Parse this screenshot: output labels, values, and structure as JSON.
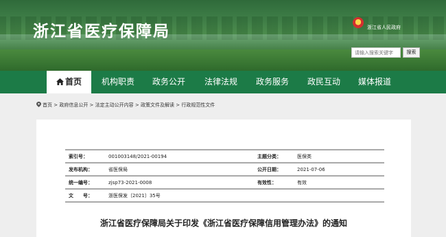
{
  "header": {
    "site_title": "浙江省医疗保障局",
    "gov_label": "浙江省人民政府",
    "search_placeholder": "请输入搜索关键字",
    "search_button": "搜索"
  },
  "nav": {
    "items": [
      {
        "label": "首页",
        "active": true
      },
      {
        "label": "机构职责"
      },
      {
        "label": "政务公开"
      },
      {
        "label": "法律法规"
      },
      {
        "label": "政务服务"
      },
      {
        "label": "政民互动"
      },
      {
        "label": "媒体报道"
      }
    ]
  },
  "breadcrumb": {
    "items": [
      "首页",
      "政府信息公开",
      "法定主动公开内容",
      "政策文件及解读",
      "行政规范性文件"
    ],
    "separator": " > "
  },
  "meta": {
    "index_label": "索引号：",
    "index_value": "001003148/2021-00194",
    "category_label": "主题分类：",
    "category_value": "医保类",
    "issuer_label": "发布机构：",
    "issuer_value": "省医保局",
    "date_label": "公开日期：",
    "date_value": "2021-07-06",
    "serial_label": "统一编号：",
    "serial_value": "zjsp73-2021-0008",
    "validity_label": "有效性：",
    "validity_value": "有效",
    "docno_label": "文　　号：",
    "docno_value": "浙医保发〔2021〕35号"
  },
  "document": {
    "title": "浙江省医疗保障局关于印发《浙江省医疗保障信用管理办法》的通知"
  },
  "colors": {
    "nav_green": "#1c7b47",
    "banner_green": "#3f7f48"
  }
}
